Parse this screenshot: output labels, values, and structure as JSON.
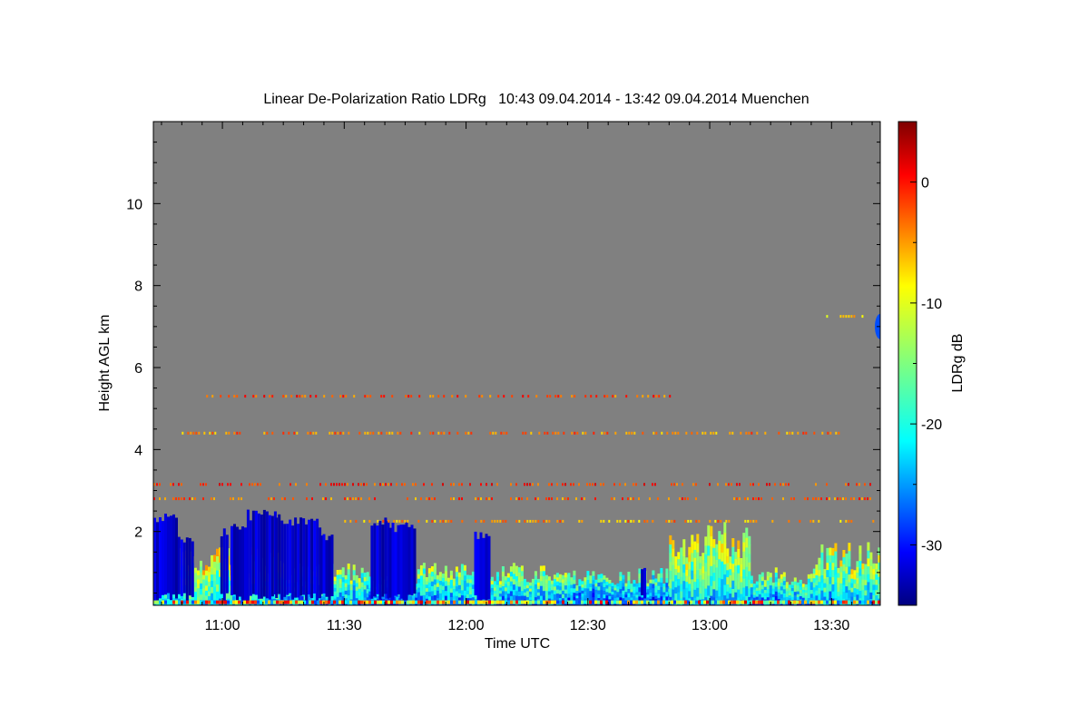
{
  "chart_data": {
    "type": "heatmap",
    "title": "Linear De-Polarization Ratio LDRg   10:43 09.04.2014 - 13:42 09.04.2014 Muenchen",
    "xlabel": "Time UTC",
    "ylabel": "Height AGL km",
    "x_range": [
      "10:43",
      "13:42"
    ],
    "xlim_minutes_since_midnight": [
      643,
      822
    ],
    "x_ticks": [
      {
        "label": "11:00",
        "minutes": 660
      },
      {
        "label": "11:30",
        "minutes": 690
      },
      {
        "label": "12:00",
        "minutes": 720
      },
      {
        "label": "12:30",
        "minutes": 750
      },
      {
        "label": "13:00",
        "minutes": 780
      },
      {
        "label": "13:30",
        "minutes": 810
      }
    ],
    "ylim": [
      0.2,
      12.0
    ],
    "y_ticks": [
      {
        "label": "2",
        "value": 2
      },
      {
        "label": "4",
        "value": 4
      },
      {
        "label": "6",
        "value": 6
      },
      {
        "label": "8",
        "value": 8
      },
      {
        "label": "10",
        "value": 10
      }
    ],
    "no_signal_color": "#808080",
    "colorbar": {
      "label": "LDRg dB",
      "range": [
        -35,
        5
      ],
      "ticks": [
        {
          "label": "0",
          "value": 0
        },
        {
          "label": "-10",
          "value": -10
        },
        {
          "label": "-20",
          "value": -20
        },
        {
          "label": "-30",
          "value": -30
        }
      ],
      "colormap": "jet"
    },
    "clouds": [
      {
        "t0": 643.0,
        "t1": 649.0,
        "h_top": 2.45,
        "ldr": -32
      },
      {
        "t0": 649.0,
        "t1": 652.5,
        "h_top": 1.9,
        "ldr": -32
      },
      {
        "t0": 659.5,
        "t1": 661.5,
        "h_top": 2.1,
        "ldr": -32
      },
      {
        "t0": 662.0,
        "t1": 666.0,
        "h_top": 2.3,
        "ldr": -32
      },
      {
        "t0": 666.0,
        "t1": 673.0,
        "h_top": 2.55,
        "ldr": -32
      },
      {
        "t0": 673.0,
        "t1": 677.0,
        "h_top": 2.45,
        "ldr": -32
      },
      {
        "t0": 677.0,
        "t1": 684.0,
        "h_top": 2.35,
        "ldr": -32
      },
      {
        "t0": 684.0,
        "t1": 687.0,
        "h_top": 2.0,
        "ldr": -32
      },
      {
        "t0": 696.5,
        "t1": 701.0,
        "h_top": 2.35,
        "ldr": -32
      },
      {
        "t0": 701.0,
        "t1": 707.5,
        "h_top": 2.25,
        "ldr": -32
      },
      {
        "t0": 722.0,
        "t1": 726.0,
        "h_top": 2.05,
        "ldr": -32
      },
      {
        "t0": 763.0,
        "t1": 764.0,
        "h_top": 1.2,
        "ldr": -32
      }
    ],
    "low_aerosol_layers": [
      {
        "t0": 643.0,
        "t1": 674.0,
        "h_top": 1.3,
        "ldr": -9
      },
      {
        "t0": 674.0,
        "t1": 696.0,
        "h_top": 1.0,
        "ldr": -13
      },
      {
        "t0": 696.0,
        "t1": 708.0,
        "h_top": 0.9,
        "ldr": -16
      },
      {
        "t0": 708.0,
        "t1": 745.0,
        "h_top": 1.0,
        "ldr": -13
      },
      {
        "t0": 745.0,
        "t1": 770.0,
        "h_top": 0.9,
        "ldr": -16
      },
      {
        "t0": 770.0,
        "t1": 790.0,
        "h_top": 1.8,
        "ldr": -10
      },
      {
        "t0": 790.0,
        "t1": 806.0,
        "h_top": 0.9,
        "ldr": -14
      },
      {
        "t0": 806.0,
        "t1": 822.0,
        "h_top": 1.4,
        "ldr": -11
      }
    ],
    "speckle_bands": [
      {
        "h": 3.15,
        "t0": 643,
        "t1": 822,
        "ldr": -2
      },
      {
        "h": 2.8,
        "t0": 643,
        "t1": 822,
        "ldr": -4
      },
      {
        "h": 2.25,
        "t0": 690,
        "t1": 822,
        "ldr": -6
      },
      {
        "h": 4.4,
        "t0": 650,
        "t1": 812,
        "ldr": -5
      },
      {
        "h": 7.25,
        "t0": 808,
        "t1": 818,
        "ldr": -8
      },
      {
        "h": 5.3,
        "t0": 656,
        "t1": 770,
        "ldr": -3
      }
    ],
    "high_cloud": {
      "t": 822,
      "h": 7.0,
      "ldr": -27
    }
  }
}
